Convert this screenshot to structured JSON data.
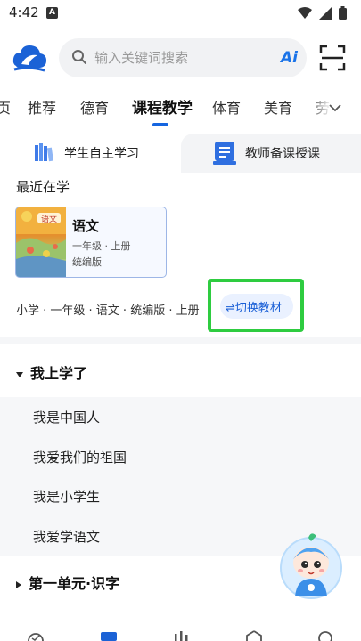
{
  "status": {
    "time": "4:42",
    "badge": "A"
  },
  "search": {
    "placeholder": "输入关键词搜索",
    "ai_label": "Ai"
  },
  "tabs": [
    {
      "label": "页"
    },
    {
      "label": "推荐"
    },
    {
      "label": "德育"
    },
    {
      "label": "课程教学",
      "active": true
    },
    {
      "label": "体育"
    },
    {
      "label": "美育"
    },
    {
      "label": "劳"
    }
  ],
  "modes": {
    "student": "学生自主学习",
    "teacher": "教师备课授课"
  },
  "recent": {
    "title": "最近在学",
    "course": {
      "title": "语文",
      "grade": "一年级 · 上册",
      "edition": "统编版",
      "cover_text": "语文"
    }
  },
  "breadcrumb": "小学 · 一年级 · 语文 · 统编版 · 上册",
  "switch": {
    "label": "⇌切换教材"
  },
  "groups": [
    {
      "title": "我上学了",
      "expanded": true,
      "lessons": [
        "我是中国人",
        "我爱我们的祖国",
        "我是小学生",
        "我爱学语文"
      ]
    },
    {
      "title": "第一单元·识字",
      "expanded": false
    }
  ],
  "colors": {
    "accent": "#1565e0",
    "highlight_box": "#2ecc40"
  }
}
